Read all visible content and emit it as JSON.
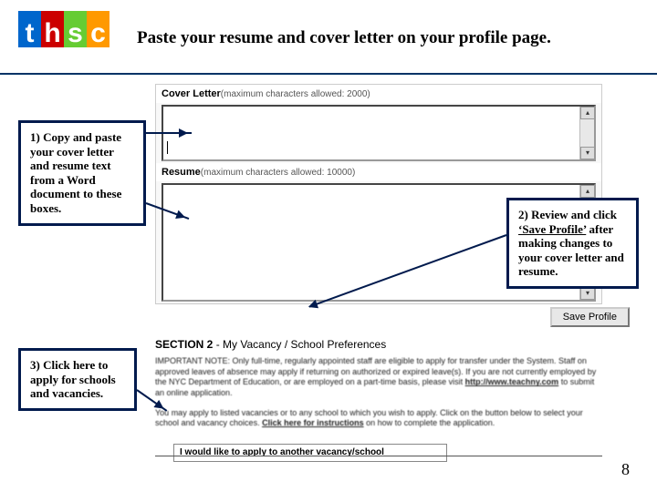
{
  "header": {
    "logo_letters": [
      "t",
      "h",
      "s",
      "c"
    ],
    "title": "Paste your resume and cover letter on your profile page."
  },
  "form": {
    "cover_label": "Cover Letter",
    "cover_hint": "(maximum characters allowed: 2000)",
    "resume_label": "Resume",
    "resume_hint": "(maximum characters allowed: 10000)",
    "save_label": "Save Profile"
  },
  "section2": {
    "heading_bold": "SECTION 2",
    "heading_rest": " - My Vacancy / School Preferences",
    "note_label": "IMPORTANT NOTE:",
    "note_body": " Only full-time, regularly appointed staff are eligible to apply for transfer under the System. Staff on approved leaves of absence may apply if returning on authorized or expired leave(s). If you are not currently employed by the NYC Department of Education, or are employed on a part-time basis, please visit ",
    "note_link": "http://www.teachny.com",
    "note_tail": " to submit an online application.",
    "para2_a": "You may apply to listed vacancies or to any school to which you wish to apply. Click on the button below to select your school and vacancy choices. ",
    "para2_link": "Click here for instructions",
    "para2_b": " on how to complete the application.",
    "apply_option": "I would like to apply to another vacancy/school"
  },
  "callouts": {
    "c1": "1) Copy and paste your cover letter and resume text from a Word document to these boxes.",
    "c2": "2) Review and click ‘Save Profile’ after making changes to your cover letter and resume.",
    "c3": "3) Click here to apply for schools and vacancies."
  },
  "page_number": "8"
}
